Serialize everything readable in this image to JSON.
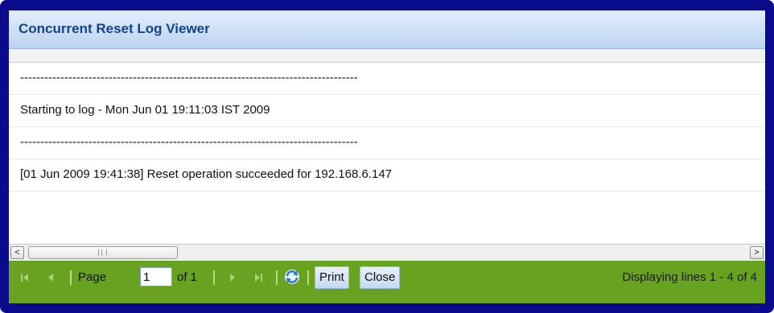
{
  "window": {
    "title": "Concurrent Reset Log Viewer"
  },
  "log": {
    "lines": [
      "------------------------------------------------------------------------------------",
      "Starting to log - Mon Jun 01 19:11:03 IST 2009",
      "------------------------------------------------------------------------------------",
      "[01 Jun 2009 19:41:38] Reset operation succeeded for 192.168.6.147"
    ]
  },
  "scrollbar": {
    "left_arrow": "<",
    "right_arrow": ">",
    "grip": "III"
  },
  "paging": {
    "page_label": "Page",
    "page_value": "1",
    "of_label": "of 1",
    "print_label": "Print",
    "close_label": "Close",
    "display_info": "Displaying lines 1 - 4 of 4"
  },
  "icons": {
    "first": "first-page-icon",
    "prev": "prev-page-icon",
    "next": "next-page-icon",
    "last": "last-page-icon",
    "refresh": "refresh-icon"
  },
  "colors": {
    "window_border": "#0a0a8c",
    "title_text": "#15428b",
    "toolbar": "#67a321"
  }
}
